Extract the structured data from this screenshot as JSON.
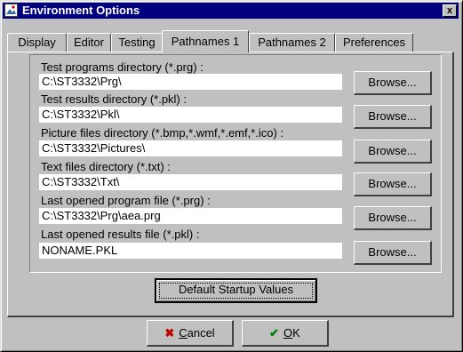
{
  "window": {
    "title": "Environment Options",
    "close_glyph": "x"
  },
  "tabs": [
    {
      "label": "Display",
      "active": false
    },
    {
      "label": "Editor",
      "active": false
    },
    {
      "label": "Testing",
      "active": false
    },
    {
      "label": "Pathnames 1",
      "active": true
    },
    {
      "label": "Pathnames 2",
      "active": false
    },
    {
      "label": "Preferences",
      "active": false
    }
  ],
  "paths": [
    {
      "label": "Test programs directory (*.prg) :",
      "value": "C:\\ST3332\\Prg\\",
      "button": "Browse..."
    },
    {
      "label": "Test results directory (*.pkl) :",
      "value": "C:\\ST3332\\Pkl\\",
      "button": "Browse..."
    },
    {
      "label": "Picture files directory (*.bmp,*.wmf,*.emf,*.ico) :",
      "value": "C:\\ST3332\\Pictures\\",
      "button": "Browse..."
    },
    {
      "label": "Text files directory (*.txt) :",
      "value": "C:\\ST3332\\Txt\\",
      "button": "Browse..."
    },
    {
      "label": "Last opened program file (*.prg) :",
      "value": "C:\\ST3332\\Prg\\aea.prg",
      "button": "Browse..."
    },
    {
      "label": "Last opened results file (*.pkl) :",
      "value": "NONAME.PKL",
      "button": "Browse..."
    }
  ],
  "buttons": {
    "default_startup": "Default Startup Values",
    "cancel_mnemonic": "C",
    "cancel_rest": "ancel",
    "ok_mnemonic": "O",
    "ok_rest": "K"
  },
  "icons": {
    "app": "environment-app-icon",
    "cancel": "x-icon",
    "ok": "checkmark-icon"
  },
  "colors": {
    "titlebar": "#000080",
    "face": "#c0c0c0",
    "cancel_icon": "#c00000",
    "ok_icon": "#008000"
  }
}
